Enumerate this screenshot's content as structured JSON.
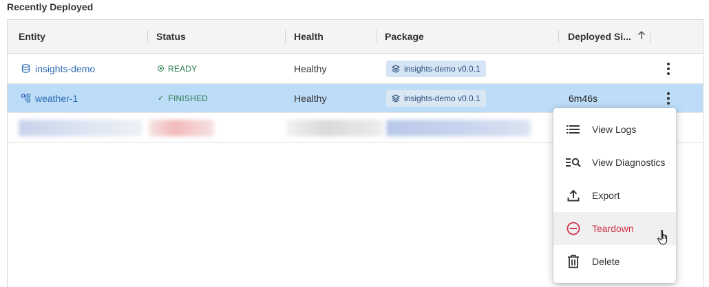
{
  "section": {
    "title": "Recently Deployed"
  },
  "table": {
    "columns": [
      "Entity",
      "Status",
      "Health",
      "Package",
      "Deployed Si..."
    ],
    "sort": {
      "column": "Deployed Si...",
      "direction": "ascending",
      "icon": "arrow-up-icon"
    },
    "rows": [
      {
        "entity": "insights-demo",
        "entity_icon": "database-icon",
        "status": "READY",
        "status_icon": "radio-dot-icon",
        "health": "Healthy",
        "package": "insights-demo v0.0.1",
        "deployed_since": "",
        "selected": false
      },
      {
        "entity": "weather-1",
        "entity_icon": "flow-icon",
        "status": "FINISHED",
        "status_icon": "check-icon",
        "health": "Healthy",
        "package": "insights-demo v0.0.1",
        "deployed_since": "6m46s",
        "selected": true
      }
    ]
  },
  "menu": {
    "items": [
      {
        "label": "View Logs",
        "icon": "list-icon"
      },
      {
        "label": "View Diagnostics",
        "icon": "search-list-icon"
      },
      {
        "label": "Export",
        "icon": "upload-icon"
      },
      {
        "label": "Teardown",
        "icon": "minus-circle-icon",
        "color": "#d0344c",
        "hovered": true
      },
      {
        "label": "Delete",
        "icon": "trash-icon"
      }
    ]
  },
  "colors": {
    "link": "#2f6cb5",
    "selected_row": "#bcdcf7",
    "status_green": "#2a7a4d",
    "chip_bg": "#d6e5f6",
    "danger": "#d0344c"
  }
}
